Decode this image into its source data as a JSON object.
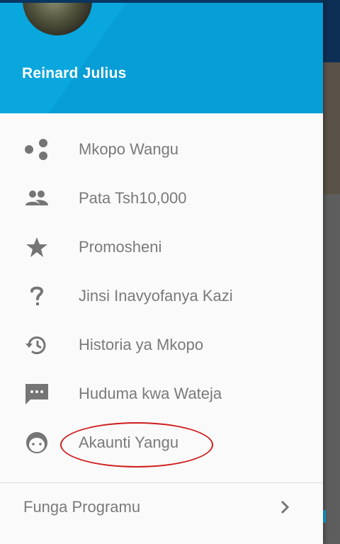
{
  "user": {
    "name": "Reinard Julius"
  },
  "menu": {
    "items": [
      {
        "label": "Mkopo Wangu",
        "icon": "dots-icon"
      },
      {
        "label": "Pata Tsh10,000",
        "icon": "people-icon"
      },
      {
        "label": "Promosheni",
        "icon": "star-icon"
      },
      {
        "label": "Jinsi Inavyofanya Kazi",
        "icon": "question-icon"
      },
      {
        "label": "Historia ya Mkopo",
        "icon": "history-icon"
      },
      {
        "label": "Huduma kwa Wateja",
        "icon": "chat-icon"
      },
      {
        "label": "Akaunti Yangu",
        "icon": "face-icon"
      }
    ]
  },
  "footer": {
    "label": "Funga Programu",
    "icon": "chevron-right-icon"
  },
  "colors": {
    "header": "#0aa6de",
    "drawer_bg": "#fafafa",
    "text": "#7a7a7a",
    "icon": "#757575",
    "annotation": "#d01c1c"
  }
}
